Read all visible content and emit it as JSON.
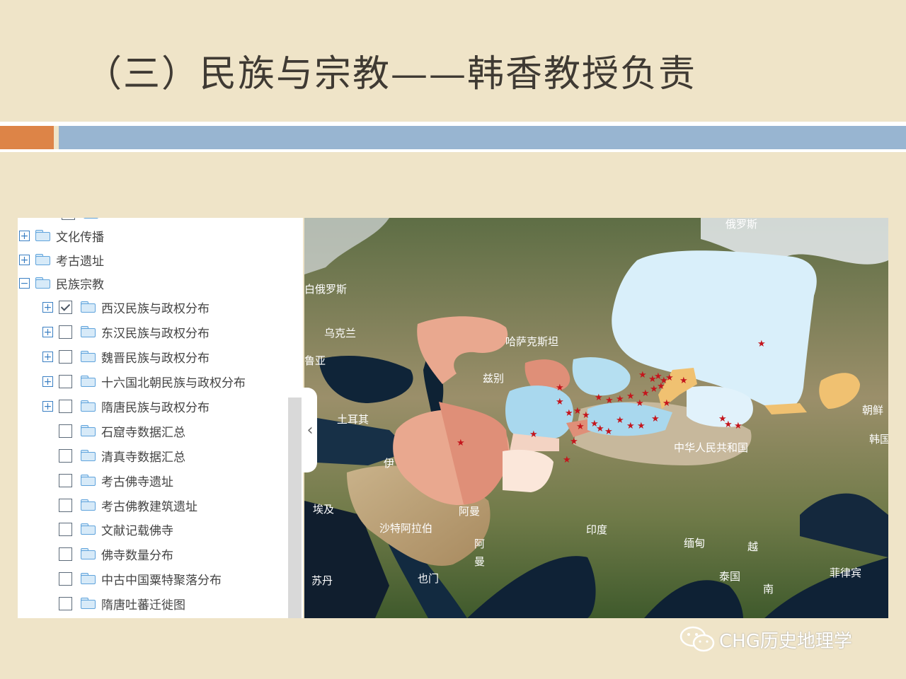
{
  "slide": {
    "title": "（三）民族与宗教——韩香教授负责",
    "watermark": "CHG历史地理学"
  },
  "tree": {
    "items": [
      {
        "label": "文化传播",
        "expander": "+",
        "checkbox": false,
        "level": 0
      },
      {
        "label": "考古遗址",
        "expander": "+",
        "checkbox": false,
        "level": 0
      },
      {
        "label": "民族宗教",
        "expander": "−",
        "checkbox": false,
        "level": 0
      },
      {
        "label": "西汉民族与政权分布",
        "expander": "+",
        "checkbox": true,
        "checked": true,
        "level": 1
      },
      {
        "label": "东汉民族与政权分布",
        "expander": "+",
        "checkbox": true,
        "checked": false,
        "level": 1
      },
      {
        "label": "魏晋民族与政权分布",
        "expander": "+",
        "checkbox": true,
        "checked": false,
        "level": 1
      },
      {
        "label": "十六国北朝民族与政权分布",
        "expander": "+",
        "checkbox": true,
        "checked": false,
        "level": 1
      },
      {
        "label": "隋唐民族与政权分布",
        "expander": "+",
        "checkbox": true,
        "checked": false,
        "level": 1
      },
      {
        "label": "石窟寺数据汇总",
        "expander": "",
        "checkbox": true,
        "checked": false,
        "level": 1
      },
      {
        "label": "清真寺数据汇总",
        "expander": "",
        "checkbox": true,
        "checked": false,
        "level": 1
      },
      {
        "label": "考古佛寺遗址",
        "expander": "",
        "checkbox": true,
        "checked": false,
        "level": 1
      },
      {
        "label": "考古佛教建筑遗址",
        "expander": "",
        "checkbox": true,
        "checked": false,
        "level": 1
      },
      {
        "label": "文献记载佛寺",
        "expander": "",
        "checkbox": true,
        "checked": false,
        "level": 1
      },
      {
        "label": "佛寺数量分布",
        "expander": "",
        "checkbox": true,
        "checked": false,
        "level": 1
      },
      {
        "label": "中古中国粟特聚落分布",
        "expander": "",
        "checkbox": true,
        "checked": false,
        "level": 1
      },
      {
        "label": "隋唐吐蕃迁徙图",
        "expander": "",
        "checkbox": true,
        "checked": false,
        "level": 1
      }
    ]
  },
  "map": {
    "collapse_glyph": "‹",
    "labels": {
      "russia": "俄罗斯",
      "belarus": "白俄罗斯",
      "ukraine": "乌克兰",
      "kazakhstan": "哈萨克斯坦",
      "georgia": "鲁亚",
      "uzbek": "兹别",
      "turkey": "土耳其",
      "iran": "伊",
      "china": "中华人民共和国",
      "korea_n": "朝鲜",
      "korea_s": "韩国",
      "egypt": "埃及",
      "saudi": "沙特阿拉伯",
      "oman": "阿曼",
      "arabia_sea": "阿",
      "arabia_sea2": "曼",
      "india": "印度",
      "myanmar": "缅甸",
      "laos": "越",
      "thailand": "泰国",
      "vietnam": "南",
      "philippines": "菲律宾",
      "sudan": "苏丹",
      "yemen": "也门"
    },
    "colors": {
      "salmon": "#e9a88f",
      "salmon_dark": "#df8f78",
      "light_blue": "#a9d8ee",
      "pale_blue": "#d9effa",
      "cream": "#fbe7da",
      "gold": "#f0c171",
      "star": "#c4151c"
    }
  }
}
